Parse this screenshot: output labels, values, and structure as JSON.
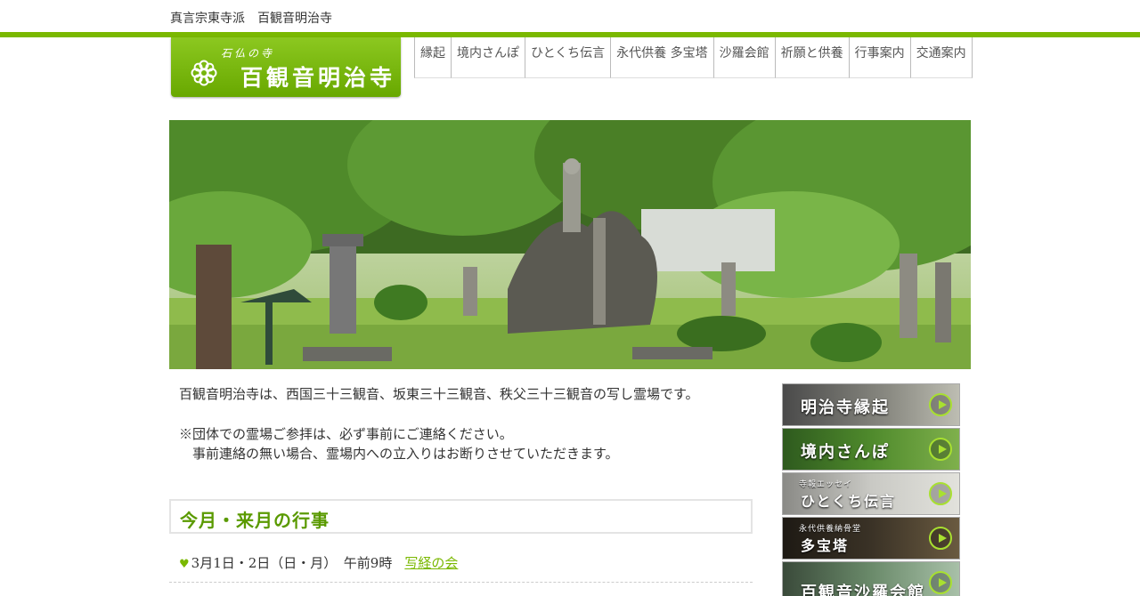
{
  "header": {
    "tagline": "真言宗東寺派　百観音明治寺",
    "logo_sub": "石仏の寺",
    "logo_main": "百観音明治寺"
  },
  "nav": {
    "items": [
      {
        "label": "縁起"
      },
      {
        "label": "境内さんぽ"
      },
      {
        "label": "ひとくち伝言"
      },
      {
        "label": "永代供養 多宝塔"
      },
      {
        "label": "沙羅会館"
      },
      {
        "label": "祈願と供養"
      },
      {
        "label": "行事案内"
      },
      {
        "label": "交通案内"
      }
    ]
  },
  "hero": {
    "alt": "stone-buddha-garden-photo"
  },
  "intro": {
    "line1": "百観音明治寺は、西国三十三観音、坂東三十三観音、秩父三十三観音の写し霊場です。",
    "line2": "※団体での霊場ご参拝は、必ず事前にご連絡ください。",
    "line3": "　事前連絡の無い場合、霊場内への立入りはお断りさせていただきます。"
  },
  "events": {
    "title": "今月・来月の行事",
    "items": [
      {
        "date": "3月1日・2日（日・月）　午前9時",
        "link": "写経の会"
      }
    ]
  },
  "sidebar": {
    "buttons": [
      {
        "label": "明治寺縁起",
        "sub": ""
      },
      {
        "label": "境内さんぽ",
        "sub": ""
      },
      {
        "label": "ひとくち伝言",
        "sub": "寺報エッセイ"
      },
      {
        "label": "多宝塔",
        "sub": "永代供養納骨堂"
      },
      {
        "label": "百観音沙羅会館",
        "sub": ""
      }
    ]
  },
  "colors": {
    "accent": "#7ab800",
    "accent_dark": "#5a9a00"
  }
}
